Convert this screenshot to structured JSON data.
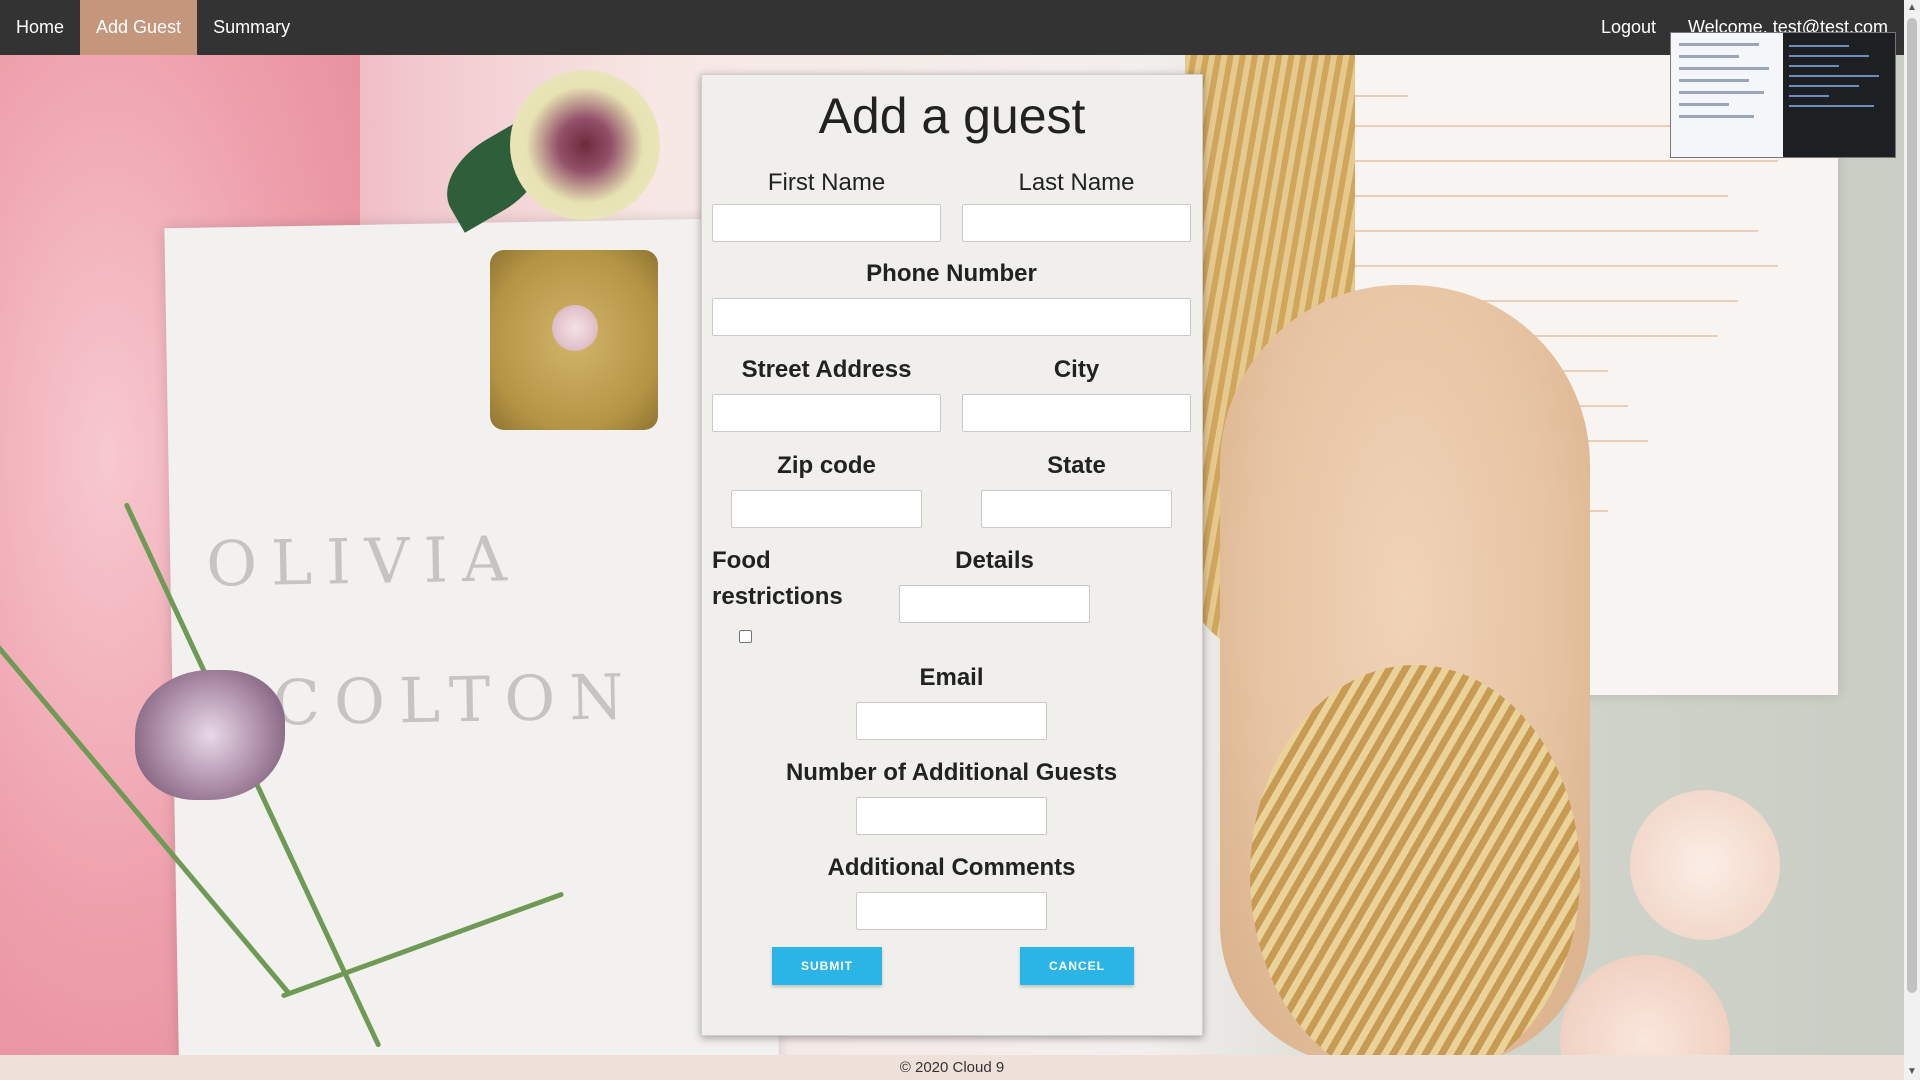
{
  "nav": {
    "home": "Home",
    "add_guest": "Add Guest",
    "summary": "Summary",
    "logout": "Logout",
    "welcome": "Welcome, test@test.com",
    "active_color": "#c4977c"
  },
  "form": {
    "title": "Add a guest",
    "first_name_label": "First Name",
    "last_name_label": "Last Name",
    "phone_label": "Phone Number",
    "street_label": "Street Address",
    "city_label": "City",
    "zip_label": "Zip code",
    "state_label": "State",
    "food_label_line1": "Food",
    "food_label_line2": "restrictions",
    "food_checked": false,
    "details_label": "Details",
    "email_label": "Email",
    "additional_guests_label": "Number of Additional Guests",
    "comments_label": "Additional Comments",
    "submit_label": "SUBMIT",
    "cancel_label": "CANCEL",
    "button_color": "#2bb4e6"
  },
  "footer": {
    "text": "© 2020 Cloud 9"
  }
}
